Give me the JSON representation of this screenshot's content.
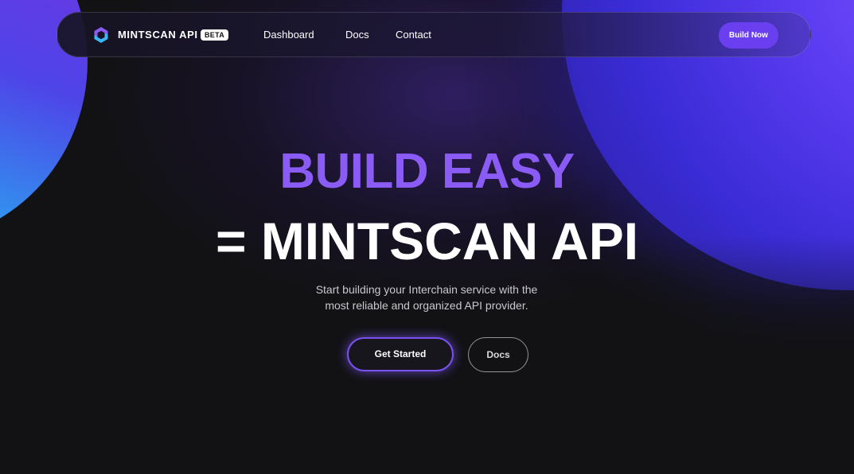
{
  "colors": {
    "background": "#121214",
    "accent": "#8a5cf5",
    "button_primary": "#6a3ff0",
    "blob_left": "#4e44e8",
    "blob_right": "#5a3bf0"
  },
  "header": {
    "logo_icon": "mintscan-logo-icon",
    "brand": "MINTSCAN API",
    "badge": "BETA",
    "nav": [
      {
        "label": "Dashboard"
      },
      {
        "label": "Docs"
      },
      {
        "label": "Contact"
      }
    ],
    "cta_label": "Build Now"
  },
  "hero": {
    "headline_1": "BUILD EASY",
    "headline_2": "= MINTSCAN API",
    "subtitle_line_1": "Start building your Interchain service with the",
    "subtitle_line_2": "most reliable and organized API provider.",
    "primary_button": "Get Started",
    "secondary_button": "Docs"
  }
}
